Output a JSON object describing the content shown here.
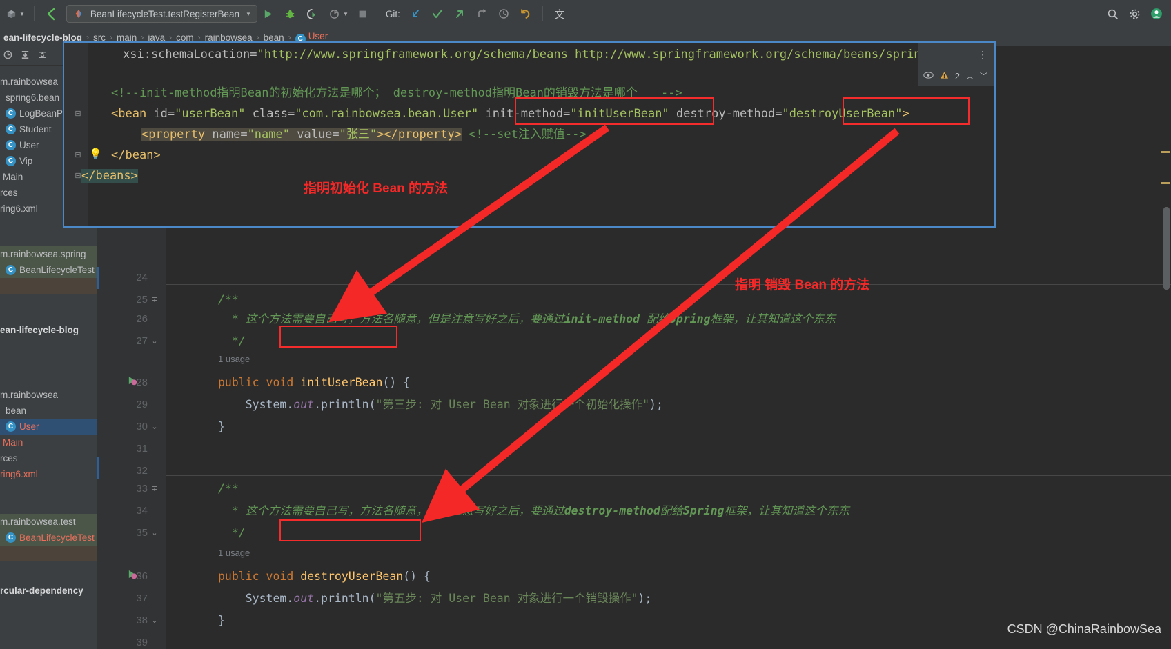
{
  "toolbar": {
    "run_config": "BeanLifecycleTest.testRegisterBean",
    "git_label": "Git:",
    "icons": {
      "project_chooser": "module-icon",
      "back": "back-arrow-icon",
      "run": "run-icon",
      "debug": "debug-icon",
      "run_coverage": "run-with-coverage-icon",
      "profile": "profiler-icon",
      "stop": "stop-icon",
      "git_update": "git-update-icon",
      "git_commit": "git-commit-icon",
      "git_push": "git-push-icon",
      "git_rollback": "git-rollback-icon",
      "history": "history-icon",
      "undo": "undo-icon",
      "translate": "translate-icon",
      "search": "search-icon",
      "settings": "gear-icon",
      "account": "account-icon"
    }
  },
  "breadcrumb": {
    "items": [
      {
        "label": "ean-lifecycle-blog",
        "style": "bold"
      },
      {
        "label": "src",
        "style": "normal"
      },
      {
        "label": "main",
        "style": "normal"
      },
      {
        "label": "java",
        "style": "normal"
      },
      {
        "label": "com",
        "style": "normal"
      },
      {
        "label": "rainbowsea",
        "style": "normal"
      },
      {
        "label": "bean",
        "style": "normal"
      },
      {
        "label": "User",
        "style": "class"
      }
    ],
    "separator": "›"
  },
  "sidebar": {
    "toolbar_icons": [
      "scroll-from-source-icon",
      "expand-all-icon",
      "collapse-all-icon"
    ],
    "items": [
      {
        "label": "m.rainbowsea",
        "kind": "package",
        "state": "normal"
      },
      {
        "label": "spring6.bean",
        "kind": "package",
        "state": "normal"
      },
      {
        "label": "LogBeanP",
        "kind": "class",
        "state": "normal"
      },
      {
        "label": "Student",
        "kind": "class",
        "state": "normal"
      },
      {
        "label": "User",
        "kind": "class",
        "state": "normal"
      },
      {
        "label": "Vip",
        "kind": "class",
        "state": "normal"
      },
      {
        "label": "Main",
        "kind": "file",
        "state": "normal"
      },
      {
        "label": "rces",
        "kind": "folder",
        "state": "normal"
      },
      {
        "label": "ring6.xml",
        "kind": "file",
        "state": "normal"
      },
      {
        "label": "m.rainbowsea.spring",
        "kind": "package",
        "state": "green"
      },
      {
        "label": "BeanLifecycleTest",
        "kind": "class",
        "state": "green"
      },
      {
        "label": "",
        "kind": "blank",
        "state": "brown"
      },
      {
        "label": "ean-lifecycle-blog",
        "kind": "module",
        "state": "bold"
      },
      {
        "label": "m.rainbowsea",
        "kind": "package",
        "state": "normal"
      },
      {
        "label": "bean",
        "kind": "package",
        "state": "normal"
      },
      {
        "label": "User",
        "kind": "class",
        "state": "selected"
      },
      {
        "label": "Main",
        "kind": "file",
        "state": "red"
      },
      {
        "label": "rces",
        "kind": "folder",
        "state": "normal"
      },
      {
        "label": "ring6.xml",
        "kind": "file",
        "state": "red"
      },
      {
        "label": "m.rainbowsea.test",
        "kind": "package",
        "state": "green"
      },
      {
        "label": "BeanLifecycleTest",
        "kind": "class",
        "state": "green-red"
      },
      {
        "label": "",
        "kind": "blank",
        "state": "brown"
      },
      {
        "label": "rcular-dependency",
        "kind": "module",
        "state": "bold"
      }
    ]
  },
  "xml_editor": {
    "lines": [
      {
        "indent": 1,
        "text": "xsi:schemaLocation=\"http://www.springframework.org/schema/beans http://www.springframework.org/schema/beans/sprin"
      },
      {
        "indent": 0,
        "text": ""
      },
      {
        "indent": 0,
        "text": "<!--init-method指明Bean的初始化方法是哪个； destroy-method指明Bean的销毁方法是哪个      -->"
      },
      {
        "indent": 0,
        "text": "<bean id=\"userBean\" class=\"com.rainbowsea.bean.User\" init-method=\"initUserBean\" destroy-method=\"destroyUserBean\">"
      },
      {
        "indent": 0,
        "text": "<property name=\"name\" value=\"张三\"></property> <!--set注入赋值-->"
      },
      {
        "indent": 0,
        "text": "</bean>"
      },
      {
        "indent": 0,
        "text": "</beans>"
      }
    ],
    "parts": {
      "schema_location_attr": "xsi:schemaLocation=",
      "schema_location_value": "\"http://www.springframework.org/schema/beans http://www.springframework.org/schema/beans/sprin",
      "comment_line": "<!--init-method指明Bean的初始化方法是哪个； destroy-method指明Bean的销毁方法是哪个",
      "comment_close": "-->",
      "bean_open": "<bean",
      "bean_id_attr": "id=",
      "bean_id_value": "\"userBean\"",
      "bean_class_attr": "class=",
      "bean_class_value": "\"com.rainbowsea.bean.User\"",
      "init_method_attr": "init-method=",
      "init_method_value": "\"initUserBean\"",
      "destroy_method_attr": "destroy-method=",
      "destroy_method_value": "\"destroyUserBean\"",
      "bean_open_close": ">",
      "property_open": "<property",
      "property_name_attr": "name=",
      "property_name_value": "\"name\"",
      "property_value_attr": "value=",
      "property_value_value": "\"张三\"",
      "property_close": "></property>",
      "set_comment": "<!--set注入赋值-->",
      "bean_close": "</bean>",
      "beans_close": "</beans>"
    },
    "inspection": {
      "eye_icon": "eye-icon",
      "warning_icon": "warning-triangle-icon",
      "warning_count": "2",
      "prev_icon": "chevron-up-icon",
      "next_icon": "chevron-down-icon",
      "more_icon": "more-vertical-icon"
    }
  },
  "java_editor": {
    "lines": [
      {
        "num": "24",
        "segments": []
      },
      {
        "num": "25",
        "segments": [
          {
            "t": "/**",
            "c": "cmt"
          }
        ],
        "fold": "∓"
      },
      {
        "num": "26",
        "segments": [
          {
            "t": "  * 这个方法需要自己写，方法名随意，但是注意写好之后，要通过",
            "c": "cmt"
          },
          {
            "t": "init-method",
            "c": "cmtb"
          },
          {
            "t": " 配给",
            "c": "cmt"
          },
          {
            "t": "Spring",
            "c": "cmtb"
          },
          {
            "t": "框架，让其知道这个东东",
            "c": "cmt"
          }
        ]
      },
      {
        "num": "27",
        "segments": [
          {
            "t": "  */",
            "c": "cmt"
          }
        ],
        "fold": "⌄"
      },
      {
        "num": "",
        "usage": "1 usage"
      },
      {
        "num": "28",
        "segments": [
          {
            "t": "public void ",
            "c": "kw"
          },
          {
            "t": "initUserBean",
            "c": "fn"
          },
          {
            "t": "() ",
            "c": "punct"
          },
          {
            "t": "{",
            "c": "brace"
          }
        ],
        "gutter_icon": "method-run-icon"
      },
      {
        "num": "29",
        "segments": [
          {
            "t": "    System.",
            "c": "punct"
          },
          {
            "t": "out",
            "c": "fld"
          },
          {
            "t": ".println(",
            "c": "punct"
          },
          {
            "t": "\"第三步: 对 User Bean 对象进行一个初始化操作\"",
            "c": "str"
          },
          {
            "t": ");",
            "c": "punct"
          }
        ]
      },
      {
        "num": "30",
        "segments": [
          {
            "t": "}",
            "c": "brace"
          }
        ],
        "fold": "⌄"
      },
      {
        "num": "31",
        "segments": []
      },
      {
        "num": "32",
        "segments": []
      },
      {
        "num": "33",
        "segments": [
          {
            "t": "/**",
            "c": "cmt"
          }
        ],
        "fold": "∓"
      },
      {
        "num": "34",
        "segments": [
          {
            "t": "  * 这个方法需要自己写，方法名随意，但是注意写好之后，要通过",
            "c": "cmt"
          },
          {
            "t": "destroy-method",
            "c": "cmtb"
          },
          {
            "t": "配给",
            "c": "cmt"
          },
          {
            "t": "Spring",
            "c": "cmtb"
          },
          {
            "t": "框架，让其知道这个东东",
            "c": "cmt"
          }
        ]
      },
      {
        "num": "35",
        "segments": [
          {
            "t": "  */",
            "c": "cmt"
          }
        ],
        "fold": "⌄"
      },
      {
        "num": "",
        "usage": "1 usage"
      },
      {
        "num": "36",
        "segments": [
          {
            "t": "public void ",
            "c": "kw"
          },
          {
            "t": "destroyUserBean",
            "c": "fn"
          },
          {
            "t": "() ",
            "c": "punct"
          },
          {
            "t": "{",
            "c": "brace"
          }
        ],
        "gutter_icon": "method-run-icon"
      },
      {
        "num": "37",
        "segments": [
          {
            "t": "    System.",
            "c": "punct"
          },
          {
            "t": "out",
            "c": "fld"
          },
          {
            "t": ".println(",
            "c": "punct"
          },
          {
            "t": "\"第五步: 对 User Bean 对象进行一个销毁操作\"",
            "c": "str"
          },
          {
            "t": ");",
            "c": "punct"
          }
        ]
      },
      {
        "num": "38",
        "segments": [
          {
            "t": "}",
            "c": "brace"
          }
        ],
        "fold": "⌄"
      },
      {
        "num": "39",
        "segments": []
      }
    ]
  },
  "annotations": {
    "init_label": "指明初始化 Bean 的方法",
    "destroy_label": "指明 销毁 Bean 的方法",
    "accent_color": "#f52828",
    "boxes": [
      {
        "name": "init-method-attr-box"
      },
      {
        "name": "destroy-method-attr-box"
      },
      {
        "name": "init-user-bean-method-box"
      },
      {
        "name": "destroy-user-bean-method-box"
      }
    ]
  },
  "watermark": "CSDN @ChinaRainbowSea"
}
